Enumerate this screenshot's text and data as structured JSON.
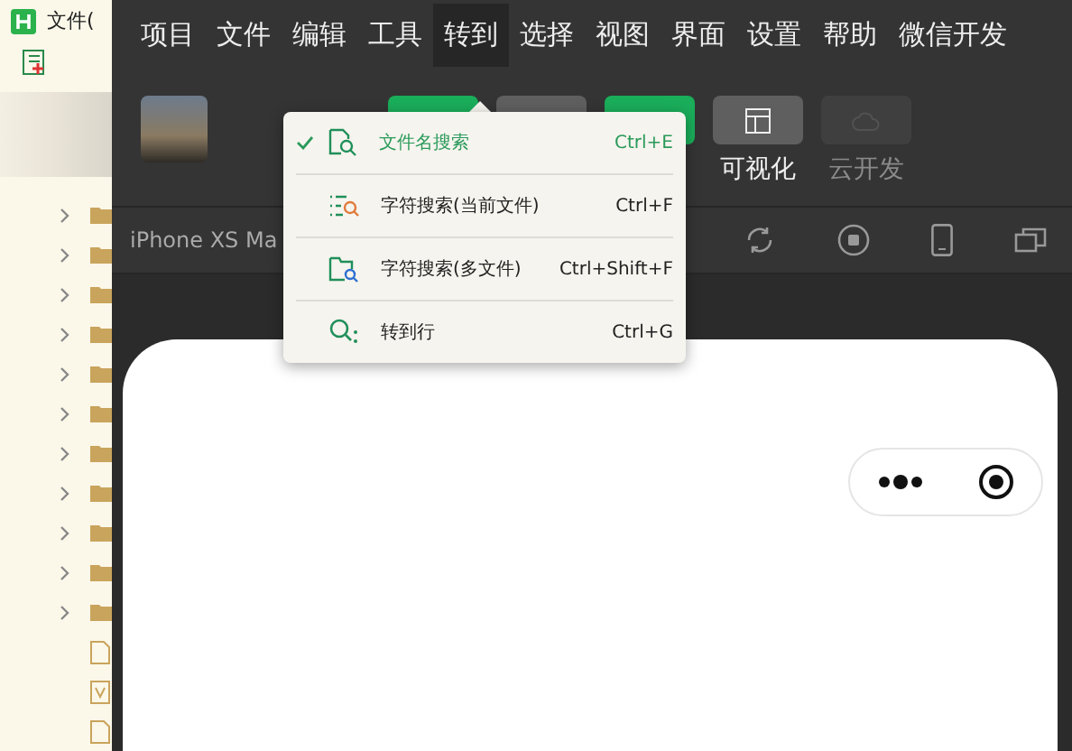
{
  "sidebar": {
    "title": "文件(",
    "tree": [
      {
        "kind": "folder",
        "expanded": false
      },
      {
        "kind": "folder",
        "expanded": false
      },
      {
        "kind": "folder",
        "expanded": false
      },
      {
        "kind": "folder",
        "expanded": false
      },
      {
        "kind": "folder",
        "expanded": false
      },
      {
        "kind": "folder",
        "expanded": false
      },
      {
        "kind": "folder",
        "expanded": false
      },
      {
        "kind": "folder",
        "expanded": false
      },
      {
        "kind": "folder",
        "expanded": false
      },
      {
        "kind": "folder",
        "expanded": false
      },
      {
        "kind": "folder",
        "expanded": false
      },
      {
        "kind": "file"
      },
      {
        "kind": "vfile"
      },
      {
        "kind": "file"
      }
    ]
  },
  "menu_bar": [
    {
      "label": "项目",
      "selected": false
    },
    {
      "label": "文件",
      "selected": false
    },
    {
      "label": "编辑",
      "selected": false
    },
    {
      "label": "工具",
      "selected": false
    },
    {
      "label": "转到",
      "selected": true
    },
    {
      "label": "选择",
      "selected": false
    },
    {
      "label": "视图",
      "selected": false
    },
    {
      "label": "界面",
      "selected": false
    },
    {
      "label": "设置",
      "selected": false
    },
    {
      "label": "帮助",
      "selected": false
    },
    {
      "label": "微信开发",
      "selected": false
    }
  ],
  "toolbar": [
    {
      "kind": "green",
      "disabled": false
    },
    {
      "kind": "grey",
      "disabled": false
    },
    {
      "kind": "green",
      "disabled": false
    },
    {
      "kind": "layout",
      "label": "可视化",
      "disabled": false
    },
    {
      "kind": "cloud",
      "label": "云开发",
      "disabled": true
    }
  ],
  "device_bar": {
    "device": "iPhone XS Ma"
  },
  "dropdown": [
    {
      "kind": "file-search",
      "label": "文件名搜索",
      "shortcut": "Ctrl+E",
      "checked": true
    },
    {
      "kind": "text-search",
      "label": "字符搜索(当前文件)",
      "shortcut": "Ctrl+F",
      "checked": false
    },
    {
      "kind": "folder-search",
      "label": "字符搜索(多文件)",
      "shortcut": "Ctrl+Shift+F",
      "checked": false
    },
    {
      "kind": "goto-line",
      "label": "转到行",
      "shortcut": "Ctrl+G",
      "checked": false
    }
  ]
}
